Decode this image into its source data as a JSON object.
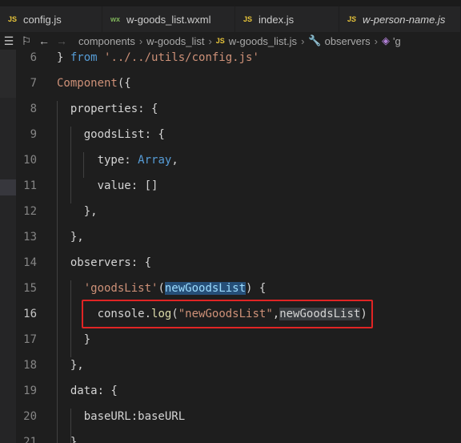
{
  "tabs": [
    {
      "icon": "JS",
      "label": "config.js"
    },
    {
      "icon": "wx",
      "label": "w-goods_list.wxml"
    },
    {
      "icon": "JS",
      "label": "index.js"
    },
    {
      "icon": "JS",
      "label": "w-person-name.js"
    }
  ],
  "breadcrumb": {
    "items": [
      "components",
      "w-goods_list",
      "w-goods_list.js",
      "observers",
      "'g"
    ]
  },
  "code": {
    "lines": [
      {
        "n": "6",
        "parts": [
          {
            "t": "} ",
            "c": "prop"
          },
          {
            "t": "from",
            "c": "kw"
          },
          {
            "t": " ",
            "c": "prop"
          },
          {
            "t": "'../../utils/config.js'",
            "c": "str"
          }
        ]
      },
      {
        "n": "7",
        "parts": [
          {
            "t": "Component",
            "c": "cls"
          },
          {
            "t": "({",
            "c": "prop"
          }
        ]
      },
      {
        "n": "8",
        "parts": [
          {
            "t": "  properties: {",
            "c": "prop"
          }
        ]
      },
      {
        "n": "9",
        "parts": [
          {
            "t": "    goodsList: {",
            "c": "prop"
          }
        ]
      },
      {
        "n": "10",
        "parts": [
          {
            "t": "      type: ",
            "c": "prop"
          },
          {
            "t": "Array",
            "c": "kw"
          },
          {
            "t": ",",
            "c": "prop"
          }
        ]
      },
      {
        "n": "11",
        "parts": [
          {
            "t": "      value: []",
            "c": "prop"
          }
        ]
      },
      {
        "n": "12",
        "parts": [
          {
            "t": "    },",
            "c": "prop"
          }
        ]
      },
      {
        "n": "13",
        "parts": [
          {
            "t": "  },",
            "c": "prop"
          }
        ]
      },
      {
        "n": "14",
        "parts": [
          {
            "t": "  observers: {",
            "c": "prop"
          }
        ]
      },
      {
        "n": "15",
        "parts": [
          {
            "t": "    ",
            "c": "prop"
          },
          {
            "t": "'goodsList'",
            "c": "str"
          },
          {
            "t": "(",
            "c": "prop"
          },
          {
            "t": "newGoodsList",
            "c": "param"
          },
          {
            "t": ") {",
            "c": "prop"
          }
        ]
      },
      {
        "n": "16",
        "parts": [
          {
            "t": "      console.",
            "c": "prop"
          },
          {
            "t": "log",
            "c": "fn"
          },
          {
            "t": "(",
            "c": "prop"
          },
          {
            "t": "\"newGoodsList\"",
            "c": "str"
          },
          {
            "t": ",",
            "c": "prop"
          },
          {
            "t": "newGoodsList",
            "c": "param2"
          },
          {
            "t": ")",
            "c": "prop"
          }
        ]
      },
      {
        "n": "17",
        "parts": [
          {
            "t": "    }",
            "c": "prop"
          }
        ]
      },
      {
        "n": "18",
        "parts": [
          {
            "t": "  },",
            "c": "prop"
          }
        ]
      },
      {
        "n": "19",
        "parts": [
          {
            "t": "  data: {",
            "c": "prop"
          }
        ]
      },
      {
        "n": "20",
        "parts": [
          {
            "t": "    baseURL:baseURL",
            "c": "prop"
          }
        ]
      },
      {
        "n": "21",
        "parts": [
          {
            "t": "  }",
            "c": "prop"
          }
        ]
      }
    ]
  }
}
